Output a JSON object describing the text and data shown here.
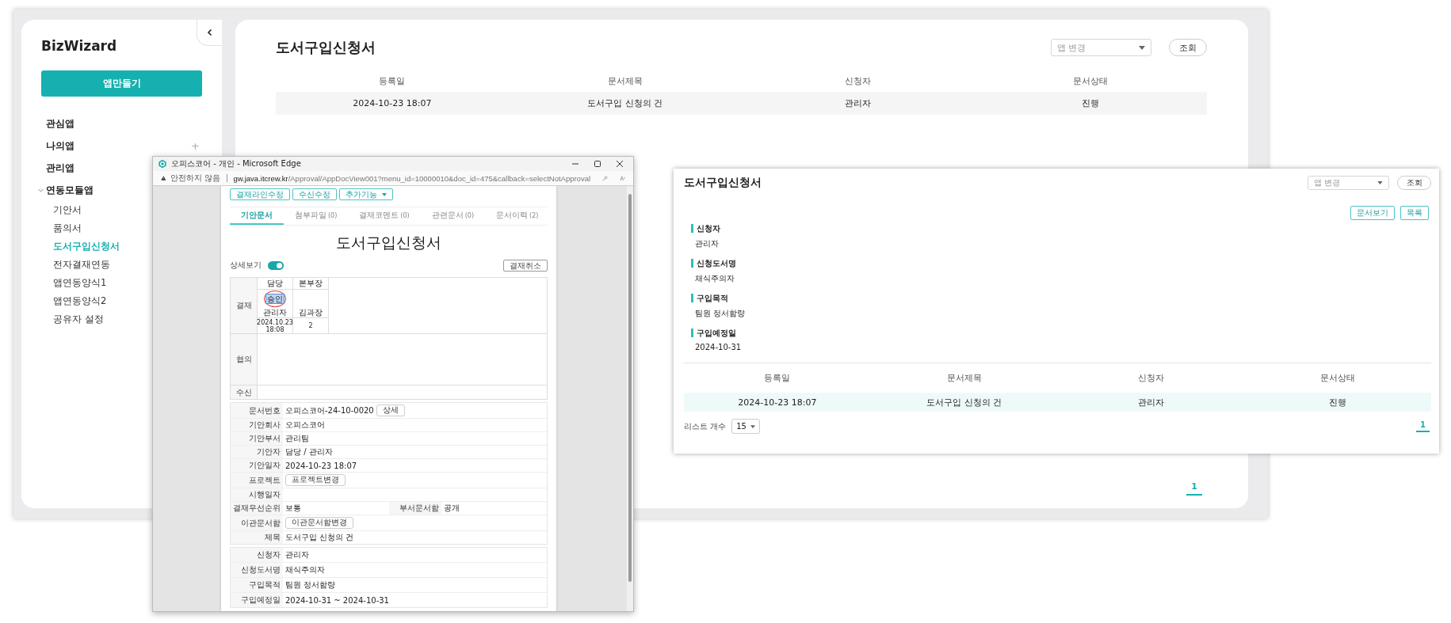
{
  "sidebar": {
    "brand": "BizWizard",
    "create_button": "앱만들기",
    "sections": [
      {
        "label": "관심앱"
      },
      {
        "label": "나의앱",
        "add": "+"
      },
      {
        "label": "관리앱"
      },
      {
        "label": "연동모듈앱",
        "expanded": true,
        "children": [
          {
            "label": "기안서",
            "selected": false
          },
          {
            "label": "품의서",
            "selected": false
          },
          {
            "label": "도서구입신청서",
            "selected": true
          },
          {
            "label": "전자결재연동",
            "selected": false
          },
          {
            "label": "앱연동양식1",
            "selected": false
          },
          {
            "label": "앱연동양식2",
            "selected": false
          },
          {
            "label": "공유자 설정",
            "selected": false
          }
        ]
      }
    ]
  },
  "main": {
    "title": "도서구입신청서",
    "app_select": {
      "placeholder": "앱 변경"
    },
    "search_button": "조회",
    "table": {
      "columns": [
        "등록일",
        "문서제목",
        "신청자",
        "문서상태"
      ],
      "rows": [
        [
          "2024-10-23 18:07",
          "도서구입 신청의 건",
          "관리자",
          "진행"
        ]
      ]
    },
    "pagination": [
      {
        "label": "1",
        "selected": true
      }
    ]
  },
  "popup": {
    "window_title": "오피스코어 - 개인 - Microsoft Edge",
    "security": "안전하지 않음",
    "url_host": "gw.java.itcrew.kr",
    "url_path": "/Approval/AppDocView001?menu_id=10000010&doc_id=475&callback=selectNotApproval",
    "action_buttons": [
      {
        "label": "결재라인수정",
        "dropdown": false
      },
      {
        "label": "수신수정",
        "dropdown": false
      },
      {
        "label": "추가기능",
        "dropdown": true
      }
    ],
    "tabs": [
      {
        "label": "기안문서",
        "selected": true
      },
      {
        "label": "첨부파일",
        "count": "(0)",
        "selected": false
      },
      {
        "label": "결재코멘트",
        "count": "(0)",
        "selected": false
      },
      {
        "label": "관련문서",
        "count": "(0)",
        "selected": false
      },
      {
        "label": "문서이력",
        "count": "(2)",
        "selected": false
      }
    ],
    "doc_title": "도서구입신청서",
    "detail_toggle": {
      "label": "상세보기",
      "on": true
    },
    "cancel_button": "결재취소",
    "approval": {
      "label": "결재",
      "steps": [
        {
          "role": "담당",
          "stamp": "승인",
          "name": "관리자",
          "date": "2024.10.23",
          "time": "18:08"
        },
        {
          "role": "본부장",
          "name": "김과장",
          "date": "2"
        }
      ]
    },
    "consult_label": "협의",
    "receive_label": "수신",
    "info_rows": [
      {
        "kind": "text_button",
        "label": "문서번호",
        "value": "오피스코어-24-10-0020",
        "button": "상세"
      },
      {
        "kind": "text",
        "label": "기안회사",
        "value": "오피스코어"
      },
      {
        "kind": "text",
        "label": "기안부서",
        "value": "관리팀"
      },
      {
        "kind": "text",
        "label": "기안자",
        "value": "담당 / 관리자"
      },
      {
        "kind": "text",
        "label": "기안일자",
        "value": "2024-10-23 18:07"
      },
      {
        "kind": "button",
        "label": "프로젝트",
        "button": "프로젝트변경"
      },
      {
        "kind": "text",
        "label": "시행일자"
      },
      {
        "kind": "pair",
        "label": "결재우선순위",
        "value": "보통",
        "label2": "부서문서함",
        "value2": "공개"
      },
      {
        "kind": "button",
        "label": "이관문서함",
        "button": "이관문서함변경"
      },
      {
        "kind": "text",
        "label": "제목",
        "value": "도서구입 신청의 건"
      }
    ],
    "form_rows": [
      {
        "label": "신청자",
        "value": "관리자"
      },
      {
        "label": "신청도서명",
        "value": "채식주의자"
      },
      {
        "label": "구입목적",
        "value": "팀원 정서함량"
      },
      {
        "label": "구입예정일",
        "value": "2024-10-31 ~ 2024-10-31"
      }
    ]
  },
  "detail_panel": {
    "title": "도서구입신청서",
    "app_select": {
      "placeholder": "앱 변경"
    },
    "search_button": "조회",
    "buttons": [
      "문서보기",
      "목록"
    ],
    "fields": [
      {
        "label": "신청자",
        "value": "관리자"
      },
      {
        "label": "신청도서명",
        "value": "채식주의자"
      },
      {
        "label": "구입목적",
        "value": "팀원 정서함량"
      },
      {
        "label": "구입예정일",
        "value": "2024-10-31"
      }
    ],
    "table": {
      "columns": [
        "등록일",
        "문서제목",
        "신청자",
        "문서상태"
      ],
      "rows": [
        [
          "2024-10-23 18:07",
          "도서구입 신청의 건",
          "관리자",
          "진행"
        ]
      ]
    },
    "list_count_label": "리스트 개수",
    "list_count": "15",
    "pagination": [
      {
        "label": "1",
        "selected": true
      }
    ]
  }
}
